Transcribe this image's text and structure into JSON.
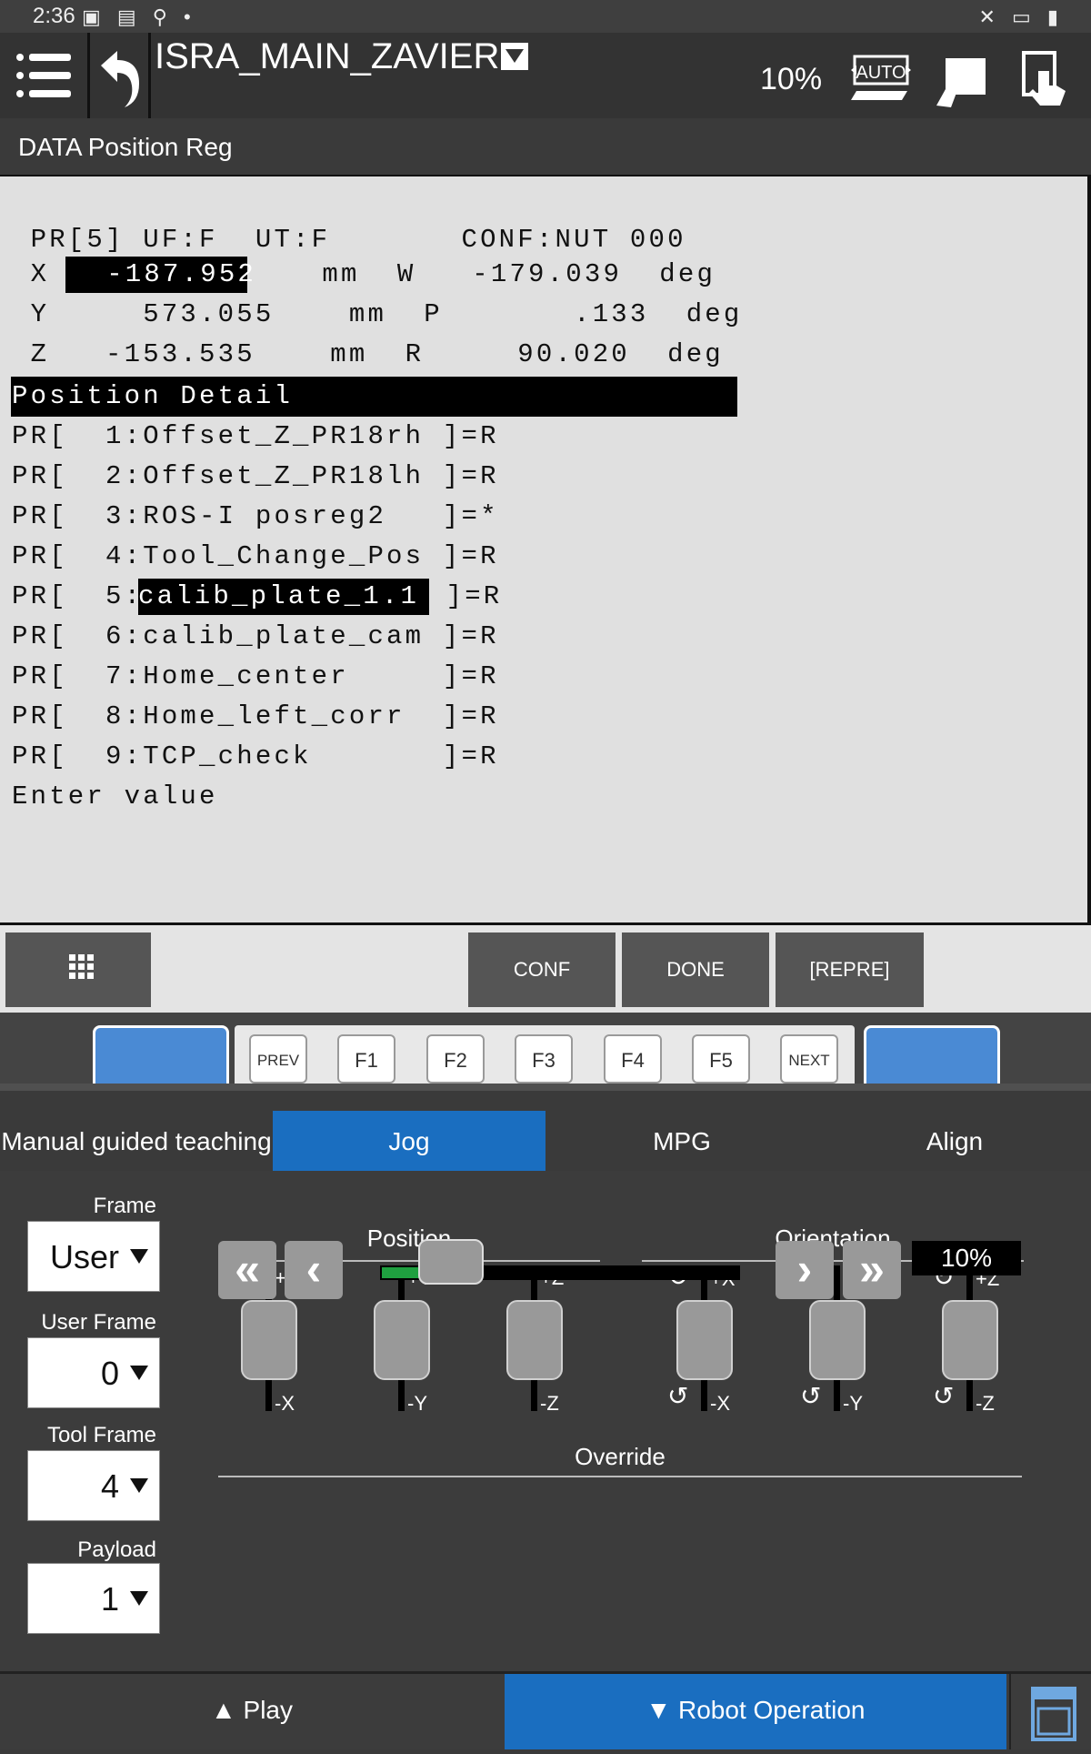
{
  "status_bar": {
    "time": "2:36"
  },
  "title_bar": {
    "program": "ISRA_MAIN_ZAVIER",
    "speed": "10%"
  },
  "screen_header": "DATA Position Reg",
  "position_register": {
    "line0": " PR[5] UF:F  UT:F       CONF:NUT 000",
    "line_x_label": " X",
    "line_x_value": "  -187.952",
    "line_x_rest": "    mm  W   -179.039  deg",
    "line_y": " Y     573.055    mm  P       .133  deg",
    "line_z": " Z   -153.535    mm  R     90.020  deg",
    "detail_header": "Position Detail",
    "list_lines": [
      "PR[  1:Offset_Z_PR18rh ]=R",
      "PR[  2:Offset_Z_PR18lh ]=R",
      "PR[  3:ROS-I posreg2   ]=*",
      "PR[  4:Tool_Change_Pos ]=R",
      "PR[  6:calib_plate_cam ]=R",
      "PR[  7:Home_center     ]=R",
      "PR[  8:Home_left_corr  ]=R",
      "PR[  9:TCP_check       ]=R"
    ],
    "pr5_prefix": "PR[  5:",
    "pr5_name": "calib_plate_1.1",
    "pr5_suffix": " ]=R",
    "prompt": "Enter value"
  },
  "function_keys": [
    "CONF",
    "DONE",
    "[REPRE]"
  ],
  "nav_keys": {
    "prev": "PREV",
    "f1": "F1",
    "f2": "F2",
    "f3": "F3",
    "f4": "F4",
    "f5": "F5",
    "next": "NEXT"
  },
  "tabs": [
    "Manual guided teaching",
    "Jog",
    "MPG",
    "Align"
  ],
  "jog": {
    "frame_label": "Frame",
    "frame_value": "User",
    "user_frame_label": "User Frame",
    "user_frame_value": "0",
    "tool_frame_label": "Tool Frame",
    "tool_frame_value": "4",
    "payload_label": "Payload",
    "payload_value": "1",
    "position_label": "Position",
    "orientation_label": "Orientation",
    "pos_plus": [
      "+X",
      "+Y",
      "+Z"
    ],
    "pos_minus": [
      "-X",
      "-Y",
      "-Z"
    ],
    "ori_plus": [
      "+X",
      "+Y",
      "+Z"
    ],
    "ori_minus": [
      "-X",
      "-Y",
      "-Z"
    ],
    "override_label": "Override",
    "override_value": "10%",
    "override_level_percent": 10
  },
  "bottom": {
    "play": "Play",
    "robot_operation": "Robot Operation"
  }
}
